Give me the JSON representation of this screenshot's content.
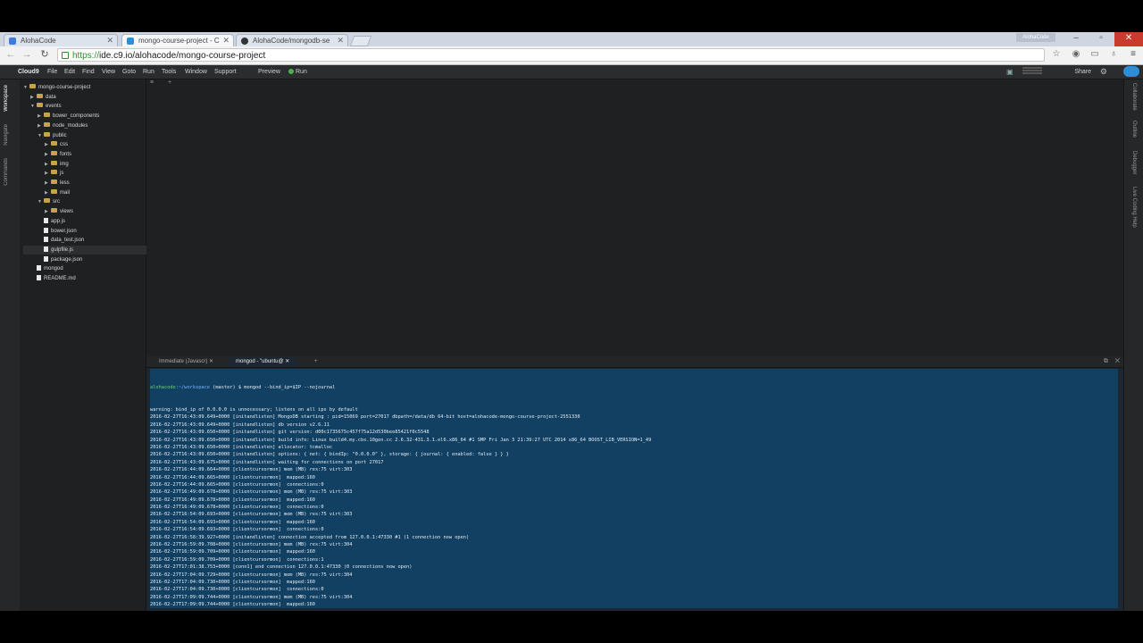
{
  "browser": {
    "tabs": [
      {
        "title": "AlohaCode",
        "active": false
      },
      {
        "title": "mongo-course-project - C",
        "active": true
      },
      {
        "title": "AlohaCode/mongodb-se",
        "active": false
      }
    ],
    "profile_name": "AlohaCode",
    "url_scheme": "https://",
    "url_rest": "ide.c9.io/alohacode/mongo-course-project"
  },
  "ide": {
    "logo": "Cloud9",
    "menu": [
      "File",
      "Edit",
      "Find",
      "View",
      "Goto",
      "Run",
      "Tools",
      "Window",
      "Support"
    ],
    "preview_label": "Preview",
    "run_label": "Run",
    "share_label": "Share",
    "left_rail": [
      "Workspace",
      "Navigate",
      "Commands"
    ],
    "right_rail": [
      "Collaborate",
      "Outline",
      "Debugger",
      "Live Coding Help"
    ]
  },
  "tree": [
    {
      "label": "mongo-course-project",
      "depth": 0,
      "type": "folder",
      "open": true
    },
    {
      "label": "data",
      "depth": 1,
      "type": "folder",
      "open": false
    },
    {
      "label": "events",
      "depth": 1,
      "type": "folder",
      "open": true
    },
    {
      "label": "bower_components",
      "depth": 2,
      "type": "folder",
      "open": false
    },
    {
      "label": "node_modules",
      "depth": 2,
      "type": "folder",
      "open": false
    },
    {
      "label": "public",
      "depth": 2,
      "type": "folder",
      "open": true
    },
    {
      "label": "css",
      "depth": 3,
      "type": "folder",
      "open": false
    },
    {
      "label": "fonts",
      "depth": 3,
      "type": "folder",
      "open": false
    },
    {
      "label": "img",
      "depth": 3,
      "type": "folder",
      "open": false
    },
    {
      "label": "js",
      "depth": 3,
      "type": "folder",
      "open": false
    },
    {
      "label": "less",
      "depth": 3,
      "type": "folder",
      "open": false
    },
    {
      "label": "mail",
      "depth": 3,
      "type": "folder",
      "open": false
    },
    {
      "label": "src",
      "depth": 2,
      "type": "folder",
      "open": true
    },
    {
      "label": "views",
      "depth": 3,
      "type": "folder",
      "open": false
    },
    {
      "label": "app.js",
      "depth": 2,
      "type": "file"
    },
    {
      "label": "bower.json",
      "depth": 2,
      "type": "file"
    },
    {
      "label": "data_test.json",
      "depth": 2,
      "type": "file"
    },
    {
      "label": "gulpfile.js",
      "depth": 2,
      "type": "file",
      "selected": true
    },
    {
      "label": "package.json",
      "depth": 2,
      "type": "file"
    },
    {
      "label": "mongod",
      "depth": 1,
      "type": "file"
    },
    {
      "label": "README.md",
      "depth": 1,
      "type": "file"
    }
  ],
  "terminal": {
    "tabs": [
      "Immediate (Javascr)",
      "mongod - \"ubuntu@"
    ],
    "prompt_user": "alohacode",
    "prompt_path": ":~/workspace",
    "prompt_rest": " (master) $ mongod --bind_ip=$IP --nojournal",
    "lines": [
      "warning: bind_ip of 0.0.0.0 is unnecessary; listens on all ips by default",
      "2016-02-27T16:43:09.649+0000 [initandlisten] MongoDB starting : pid=15069 port=27017 dbpath=/data/db 64-bit host=alohacode-mongo-course-project-2551330",
      "2016-02-27T16:43:09.649+0000 [initandlisten] db version v2.6.11",
      "2016-02-27T16:43:09.650+0000 [initandlisten] git version: d00c1735675c457f75a12d530bee85421f0c5548",
      "2016-02-27T16:43:09.650+0000 [initandlisten] build info: Linux build4.my.cbs.10gen.cc 2.6.32-431.3.1.el6.x86_64 #1 SMP Fri Jan 3 21:39:27 UTC 2014 x86_64 BOOST_LIB_VERSION=1_49",
      "2016-02-27T16:43:09.650+0000 [initandlisten] allocator: tcmalloc",
      "2016-02-27T16:43:09.650+0000 [initandlisten] options: { net: { bindIp: \"0.0.0.0\" }, storage: { journal: { enabled: false } } }",
      "2016-02-27T16:43:09.675+0000 [initandlisten] waiting for connections on port 27017",
      "2016-02-27T16:44:09.664+0000 [clientcursormon] mem (MB) res:75 virt:303",
      "2016-02-27T16:44:09.665+0000 [clientcursormon]  mapped:160",
      "2016-02-27T16:44:09.665+0000 [clientcursormon]  connections:0",
      "2016-02-27T16:49:09.678+0000 [clientcursormon] mem (MB) res:75 virt:303",
      "2016-02-27T16:49:09.678+0000 [clientcursormon]  mapped:160",
      "2016-02-27T16:49:09.678+0000 [clientcursormon]  connections:0",
      "2016-02-27T16:54:09.693+0000 [clientcursormon] mem (MB) res:75 virt:303",
      "2016-02-27T16:54:09.693+0000 [clientcursormon]  mapped:160",
      "2016-02-27T16:54:09.693+0000 [clientcursormon]  connections:0",
      "2016-02-27T16:58:39.927+0000 [initandlisten] connection accepted from 127.0.0.1:47330 #1 (1 connection now open)",
      "2016-02-27T16:59:09.708+0000 [clientcursormon] mem (MB) res:75 virt:304",
      "2016-02-27T16:59:09.709+0000 [clientcursormon]  mapped:160",
      "2016-02-27T16:59:09.709+0000 [clientcursormon]  connections:1",
      "2016-02-27T17:01:38.753+0000 [conn1] end connection 127.0.0.1:47330 (0 connections now open)",
      "2016-02-27T17:04:09.729+0000 [clientcursormon] mem (MB) res:75 virt:304",
      "2016-02-27T17:04:09.730+0000 [clientcursormon]  mapped:160",
      "2016-02-27T17:04:09.730+0000 [clientcursormon]  connections:0",
      "2016-02-27T17:09:09.744+0000 [clientcursormon] mem (MB) res:75 virt:304",
      "2016-02-27T17:09:09.744+0000 [clientcursormon]  mapped:160",
      "2016-02-27T17:09:09.744+0000 [clientcursormon]  connections:0"
    ]
  }
}
